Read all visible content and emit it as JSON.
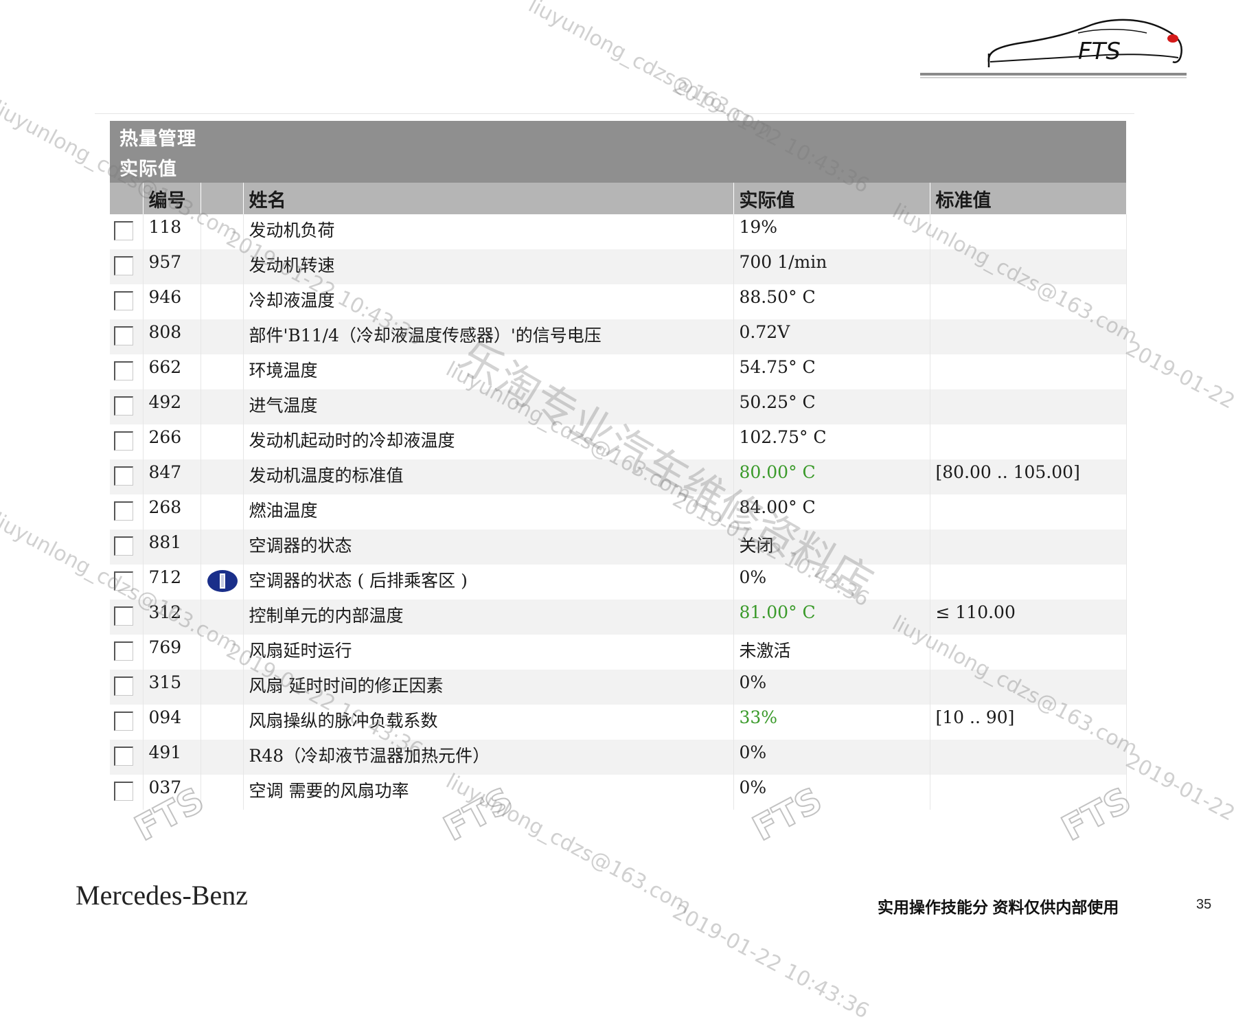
{
  "panel": {
    "title": "热量管理",
    "subtitle": "实际值"
  },
  "columns": {
    "id": "编号",
    "name": "姓名",
    "actual": "实际值",
    "standard": "标准值"
  },
  "rows": [
    {
      "id": "118",
      "name": "发动机负荷",
      "actual": "19%",
      "standard": "",
      "actual_color": "normal",
      "info": false
    },
    {
      "id": "957",
      "name": "发动机转速",
      "actual": "700 1/min",
      "standard": "",
      "actual_color": "normal",
      "info": false
    },
    {
      "id": "946",
      "name": "冷却液温度",
      "actual": "88.50° C",
      "standard": "",
      "actual_color": "normal",
      "info": false
    },
    {
      "id": "808",
      "name": "部件'B11/4（冷却液温度传感器）'的信号电压",
      "actual": "0.72V",
      "standard": "",
      "actual_color": "normal",
      "info": false
    },
    {
      "id": "662",
      "name": "环境温度",
      "actual": "54.75° C",
      "standard": "",
      "actual_color": "normal",
      "info": false
    },
    {
      "id": "492",
      "name": "进气温度",
      "actual": "50.25° C",
      "standard": "",
      "actual_color": "normal",
      "info": false
    },
    {
      "id": "266",
      "name": "发动机起动时的冷却液温度",
      "actual": "102.75° C",
      "standard": "",
      "actual_color": "normal",
      "info": false
    },
    {
      "id": "847",
      "name": "发动机温度的标准值",
      "actual": "80.00° C",
      "standard": "[80.00 .. 105.00]",
      "actual_color": "green",
      "info": false
    },
    {
      "id": "268",
      "name": "燃油温度",
      "actual": "84.00° C",
      "standard": "",
      "actual_color": "normal",
      "info": false
    },
    {
      "id": "881",
      "name": "空调器的状态",
      "actual": "关闭",
      "standard": "",
      "actual_color": "normal",
      "info": false
    },
    {
      "id": "712",
      "name": "空调器的状态 ( 后排乘客区 )",
      "actual": "0%",
      "standard": "",
      "actual_color": "normal",
      "info": true
    },
    {
      "id": "312",
      "name": "控制单元的内部温度",
      "actual": "81.00° C",
      "standard": "≤ 110.00",
      "actual_color": "green",
      "info": false
    },
    {
      "id": "769",
      "name": "风扇延时运行",
      "actual": "未激活",
      "standard": "",
      "actual_color": "normal",
      "info": false
    },
    {
      "id": "315",
      "name": "风扇 延时时间的修正因素",
      "actual": "0%",
      "standard": "",
      "actual_color": "normal",
      "info": false
    },
    {
      "id": "094",
      "name": "风扇操纵的脉冲负载系数",
      "actual": "33%",
      "standard": "[10 .. 90]",
      "actual_color": "green",
      "info": false
    },
    {
      "id": "491",
      "name": "R48（冷却液节温器加热元件）",
      "actual": "0%",
      "standard": "",
      "actual_color": "normal",
      "info": false
    },
    {
      "id": "037",
      "name": "空调 需要的风扇功率",
      "actual": "0%",
      "standard": "",
      "actual_color": "normal",
      "info": false
    }
  ],
  "colors": {
    "header_bg": "#8f8f8f",
    "column_header_bg": "#b5b5b5",
    "green_value": "#3a9a2a",
    "info_icon": "#1a2f8a"
  },
  "logo": {
    "text": "FTS"
  },
  "watermarks": {
    "email": "liuyunlong_cdzs@163.com",
    "timestamp": "2019-01-22 10:43:36",
    "store": "乐淘专业汽车维修资料店",
    "fts": "FTS"
  },
  "footer": {
    "brand": "Mercedes-Benz",
    "note": "实用操作技能分 资料仅供内部使用",
    "page": "35"
  }
}
